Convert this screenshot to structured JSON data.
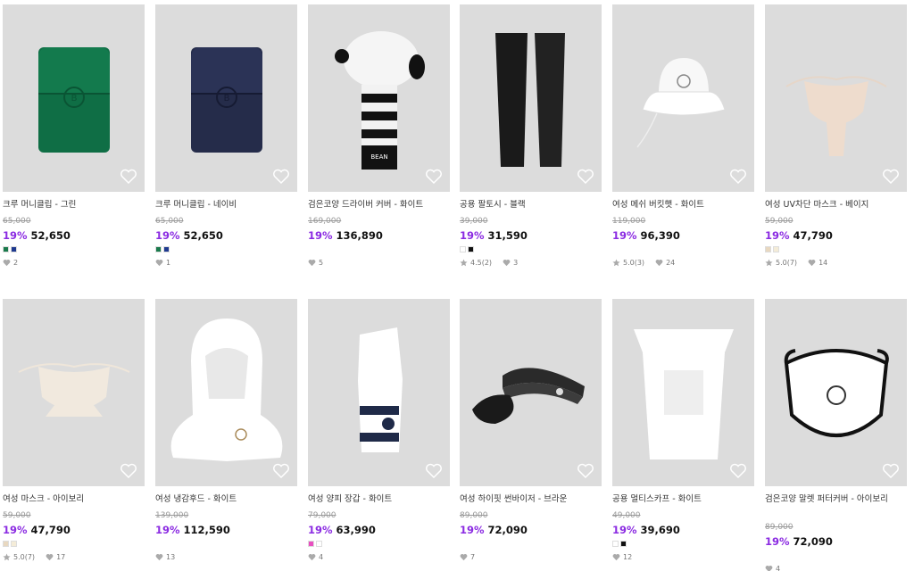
{
  "colors": {
    "discount": "#8b2be2",
    "thumb_bg": "#dcdcdc"
  },
  "products": [
    {
      "name": "크루 머니클립 - 그린",
      "original": "65,000",
      "rate": "19%",
      "price": "52,650",
      "swatches": [
        "#1a7a4c",
        "#1f3a8f"
      ],
      "rating": "",
      "likes": "2",
      "icon": "money-clip-green-image"
    },
    {
      "name": "크루 머니클립 - 네이비",
      "original": "65,000",
      "rate": "19%",
      "price": "52,650",
      "swatches": [
        "#1a7a4c",
        "#1f3a8f"
      ],
      "rating": "",
      "likes": "1",
      "icon": "money-clip-navy-image"
    },
    {
      "name": "검은코양 드라이버 커버 - 화이트",
      "original": "169,000",
      "rate": "19%",
      "price": "136,890",
      "swatches": [],
      "rating": "",
      "likes": "5",
      "icon": "driver-cover-image"
    },
    {
      "name": "공용 팔토시 - 블랙",
      "original": "39,000",
      "rate": "19%",
      "price": "31,590",
      "swatches": [
        "#ffffff",
        "#111111"
      ],
      "rating": "4.5(2)",
      "likes": "3",
      "icon": "arm-sleeve-image"
    },
    {
      "name": "여성 메쉬 버킷햇 - 화이트",
      "original": "119,000",
      "rate": "19%",
      "price": "96,390",
      "swatches": [],
      "rating": "5.0(3)",
      "likes": "24",
      "icon": "bucket-hat-image"
    },
    {
      "name": "여성 UV차단 마스크 - 베이지",
      "original": "59,000",
      "rate": "19%",
      "price": "47,790",
      "swatches": [
        "#e8d8c0",
        "#f4ecd8"
      ],
      "rating": "5.0(7)",
      "likes": "14",
      "icon": "uv-mask-beige-image"
    },
    {
      "name": "여성 마스크 - 아이보리",
      "original": "59,000",
      "rate": "19%",
      "price": "47,790",
      "swatches": [
        "#e8d8c0",
        "#f4ecd8"
      ],
      "rating": "5.0(7)",
      "likes": "17",
      "icon": "mask-ivory-image"
    },
    {
      "name": "여성 냉감후드 - 화이트",
      "original": "139,000",
      "rate": "19%",
      "price": "112,590",
      "swatches": [],
      "rating": "",
      "likes": "13",
      "icon": "cooling-hood-image"
    },
    {
      "name": "여성 양피 장갑 - 화이트",
      "original": "79,000",
      "rate": "19%",
      "price": "63,990",
      "swatches": [
        "#e84fc0",
        "#ffffff"
      ],
      "rating": "",
      "likes": "4",
      "icon": "glove-image"
    },
    {
      "name": "여성 하이핏 썬바이저 - 브라운",
      "original": "89,000",
      "rate": "19%",
      "price": "72,090",
      "swatches": [],
      "rating": "",
      "likes": "7",
      "icon": "sun-visor-image"
    },
    {
      "name": "공용 멀티스카프 - 화이트",
      "original": "49,000",
      "rate": "19%",
      "price": "39,690",
      "swatches": [
        "#ffffff",
        "#111111"
      ],
      "rating": "",
      "likes": "12",
      "icon": "multi-scarf-image"
    },
    {
      "name": "검은코양 말렛 퍼터커버 - 아이보리",
      "original": "89,000",
      "rate": "19%",
      "price": "72,090",
      "swatches": [],
      "rating": "",
      "likes": "4",
      "icon": "putter-cover-image"
    }
  ]
}
